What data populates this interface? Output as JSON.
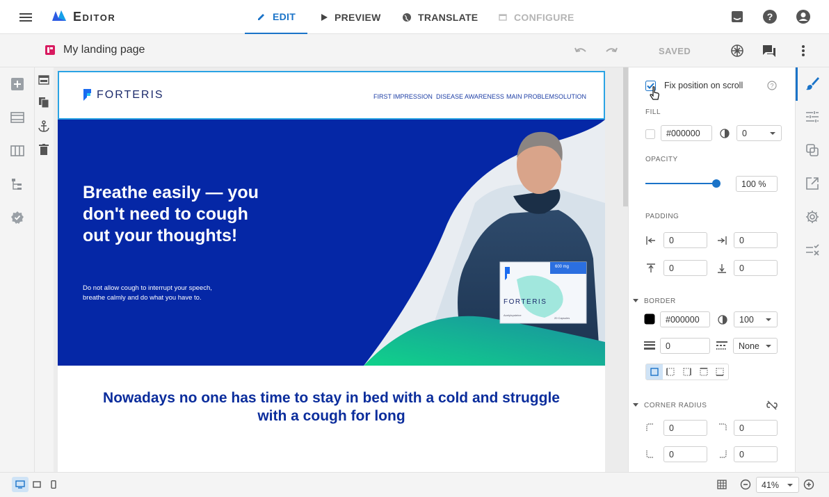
{
  "app": {
    "title": "Editor"
  },
  "tabs": [
    {
      "label": "EDIT",
      "state": "active"
    },
    {
      "label": "PREVIEW",
      "state": "normal"
    },
    {
      "label": "TRANSLATE",
      "state": "normal"
    },
    {
      "label": "CONFIGURE",
      "state": "disabled"
    }
  ],
  "subbar": {
    "page_title": "My landing page",
    "saved_label": "SAVED"
  },
  "site": {
    "brand": "FORTERIS",
    "nav": [
      "FIRST IMPRESSION",
      "DISEASE AWARENESS",
      "MAIN PROBLEMSOLUTION"
    ],
    "hero_title": "Breathe easily — you don't need to cough out your thoughts!",
    "hero_text": "Do not allow cough to interrupt your speech, breathe calmly and do what you have to.",
    "product": {
      "badge": "600 mg",
      "name": "FORTERIS",
      "sub": "Acetylcysteine",
      "count": "20 Capsules"
    },
    "section2_title": "Nowadays no one has time to stay in bed with a cold and struggle with a cough for long"
  },
  "panel": {
    "fix_position_label": "Fix position on scroll",
    "fix_position_checked": true,
    "fill_label": "FILL",
    "fill_color": "#000000",
    "fill_alpha": "0",
    "opacity_label": "OPACITY",
    "opacity_value": "100",
    "opacity_unit": "%",
    "opacity_fraction": 1.0,
    "padding_label": "PADDING",
    "padding_left": "0",
    "padding_right": "0",
    "padding_top": "0",
    "padding_bottom": "0",
    "border_label": "BORDER",
    "border_color": "#000000",
    "border_alpha": "100",
    "border_width": "0",
    "border_style": "None",
    "corner_label": "CORNER RADIUS",
    "corner_tl": "0",
    "corner_tr": "0",
    "corner_bl": "0",
    "corner_br": "0"
  },
  "bottom": {
    "zoom": "41%"
  },
  "colors": {
    "accent": "#1a73c8",
    "hero_bg": "#0527a6",
    "heading_blue": "#0b2d9c"
  }
}
